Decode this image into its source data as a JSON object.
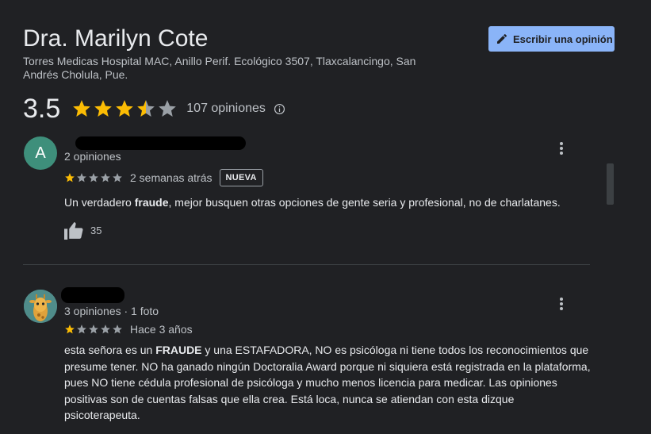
{
  "place": {
    "name": "Dra. Marilyn Cote",
    "address": "Torres Medicas Hospital MAC, Anillo Perif. Ecológico 3507, Tlaxcalancingo, San Andrés Cholula, Pue."
  },
  "write_review_label": "Escribir una opinión",
  "summary": {
    "rating": "3.5",
    "rating_value": 3.5,
    "reviews_count": "107 opiniones"
  },
  "reviews": [
    {
      "avatar_letter": "A",
      "avatar_color": "#3e8f7b",
      "reviewer_meta": "2 opiniones",
      "rating_value": 1,
      "time": "2 semanas atrás",
      "badge": "NUEVA",
      "text_parts": [
        {
          "text": "Un verdadero ",
          "bold": false
        },
        {
          "text": "fraude",
          "bold": true
        },
        {
          "text": ", mejor busquen otras opciones de gente seria y profesional, no de charlatanes.",
          "bold": false
        }
      ],
      "likes": "35"
    },
    {
      "reviewer_meta": "3 opiniones · 1 foto",
      "rating_value": 1,
      "time": "Hace 3 años",
      "text_parts": [
        {
          "text": "esta señora es un ",
          "bold": false
        },
        {
          "text": "FRAUDE",
          "bold": true
        },
        {
          "text": " y una ESTAFADORA, NO es psicóloga ni tiene todos los reconocimientos que presume tener. NO ha ganado ningún Doctoralia Award porque ni siquiera está registrada en la plataforma, pues NO tiene cédula profesional de psicóloga y mucho menos licencia para medicar. Las opiniones positivas son de cuentas falsas que ella crea. Está loca, nunca se atiendan con esta dizque psicoterapeuta.",
          "bold": false
        }
      ]
    }
  ],
  "colors": {
    "star_filled": "#fbbc04",
    "star_empty": "#9aa0a6",
    "accent": "#8ab4f8",
    "background": "#202124"
  },
  "icons": [
    "pencil-icon",
    "star-icon",
    "info-icon",
    "more-vert-icon",
    "thumb-up-icon"
  ]
}
